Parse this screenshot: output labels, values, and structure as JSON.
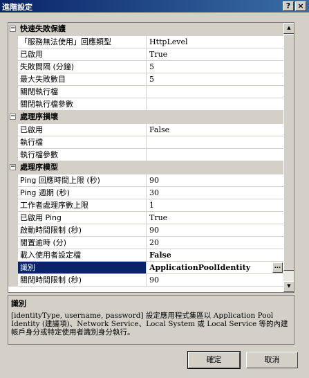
{
  "window": {
    "title": "進階設定",
    "help_glyph": "?",
    "close_glyph": "×"
  },
  "property_grid": {
    "expander_glyph": "−",
    "categories": [
      {
        "label": "快速失敗保護",
        "rows": [
          {
            "name": "「服務無法使用」回應類型",
            "value": "HttpLevel"
          },
          {
            "name": "已啟用",
            "value": "True"
          },
          {
            "name": "失敗間隔 (分鐘)",
            "value": "5"
          },
          {
            "name": "最大失敗數目",
            "value": "5"
          },
          {
            "name": "關閉執行檔",
            "value": ""
          },
          {
            "name": "關閉執行檔參數",
            "value": ""
          }
        ]
      },
      {
        "label": "處理序損壞",
        "rows": [
          {
            "name": "已啟用",
            "value": "False"
          },
          {
            "name": "執行檔",
            "value": ""
          },
          {
            "name": "執行檔參數",
            "value": ""
          }
        ]
      },
      {
        "label": "處理序模型",
        "rows": [
          {
            "name": "Ping 回應時間上限 (秒)",
            "value": "90"
          },
          {
            "name": "Ping 週期 (秒)",
            "value": "30"
          },
          {
            "name": "工作者處理序數上限",
            "value": "1"
          },
          {
            "name": "已啟用 Ping",
            "value": "True"
          },
          {
            "name": "啟動時間限制 (秒)",
            "value": "90"
          },
          {
            "name": "閒置逾時 (分)",
            "value": "20"
          },
          {
            "name": "載入使用者設定檔",
            "value": "False"
          },
          {
            "name": "識別",
            "value": "ApplicationPoolIdentity"
          },
          {
            "name": "關閉時間限制 (秒)",
            "value": "90"
          }
        ]
      }
    ],
    "ellipsis_glyph": "...",
    "scroll_up_glyph": "▲",
    "scroll_down_glyph": "▼"
  },
  "description": {
    "title": "識別",
    "text": "[identityType, username, password] 設定應用程式集區以 Application Pool Identity (建議項)、Network Service、Local System 或 Local Service 等的內建帳戶身分或特定使用者識別身分執行。"
  },
  "buttons": {
    "ok": "確定",
    "cancel": "取消"
  }
}
